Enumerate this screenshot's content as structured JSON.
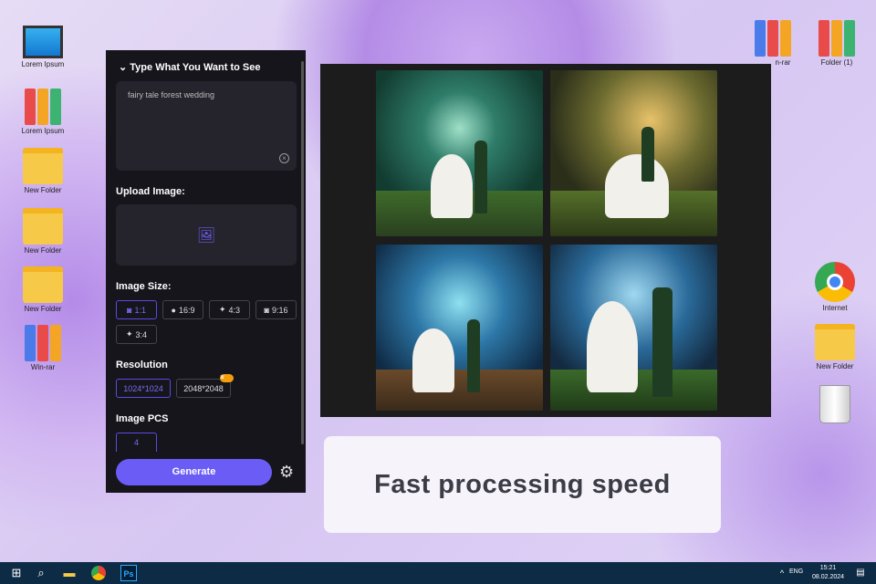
{
  "desktop": {
    "left_icons": [
      {
        "label": "Lorem Ipsum",
        "icon": "computer-icon"
      },
      {
        "label": "Lorem Ipsum",
        "icon": "binder-icon"
      },
      {
        "label": "New Folder",
        "icon": "folder-icon"
      },
      {
        "label": "New Folder",
        "icon": "folder-icon"
      },
      {
        "label": "New Folder",
        "icon": "folder-icon"
      },
      {
        "label": "Win-rar",
        "icon": "winrar-icon"
      }
    ],
    "right_icons": [
      {
        "label": "n-rar",
        "icon": "winrar-icon"
      },
      {
        "label": "Folder (1)",
        "icon": "binder-icon"
      },
      {
        "label": "Internet",
        "icon": "chrome-icon"
      },
      {
        "label": "New Folder",
        "icon": "folder-icon"
      },
      {
        "label": "",
        "icon": "trash-icon"
      }
    ]
  },
  "panel": {
    "title": "Type What You Want to See",
    "prompt": "fairy tale forest wedding",
    "upload_label": "Upload Image:",
    "size_label": "Image Size:",
    "sizes": [
      {
        "label": "1:1",
        "icon": "instagram-icon",
        "selected": true
      },
      {
        "label": "16:9",
        "icon": "facebook-icon"
      },
      {
        "label": "4:3",
        "icon": "twitter-icon"
      },
      {
        "label": "9:16",
        "icon": "instagram-icon"
      },
      {
        "label": "3:4",
        "icon": "twitter-icon"
      }
    ],
    "resolution_label": "Resolution",
    "resolutions": [
      {
        "label": "1024*1024",
        "selected": true
      },
      {
        "label": "2048*2048",
        "premium": true
      }
    ],
    "pcs_label": "Image PCS",
    "pcs_value": "4",
    "generate": "Generate"
  },
  "caption": "Fast processing speed",
  "taskbar": {
    "lang": "ENG",
    "time": "15:21",
    "date": "08.02.2024"
  },
  "colors": {
    "accent": "#6a5cf5",
    "taskbar": "#0e2b45"
  }
}
